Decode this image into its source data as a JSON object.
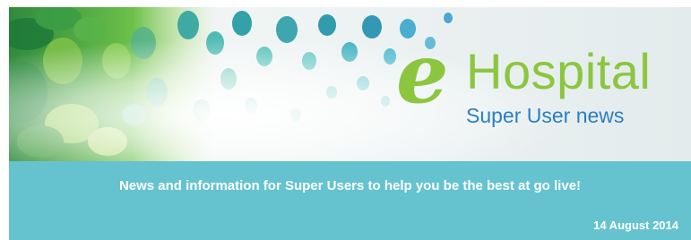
{
  "banner": {
    "logo": {
      "e_letter": "e",
      "word": "Hospital",
      "subtitle": "Super User news"
    },
    "colors": {
      "logo_green": "#8cc63f",
      "subtitle_blue": "#2b7fc1"
    }
  },
  "info_bar": {
    "tagline": "News and information for Super Users to help you be the best at go live!",
    "date": "14 August 2014",
    "background": "#65c3cf"
  }
}
